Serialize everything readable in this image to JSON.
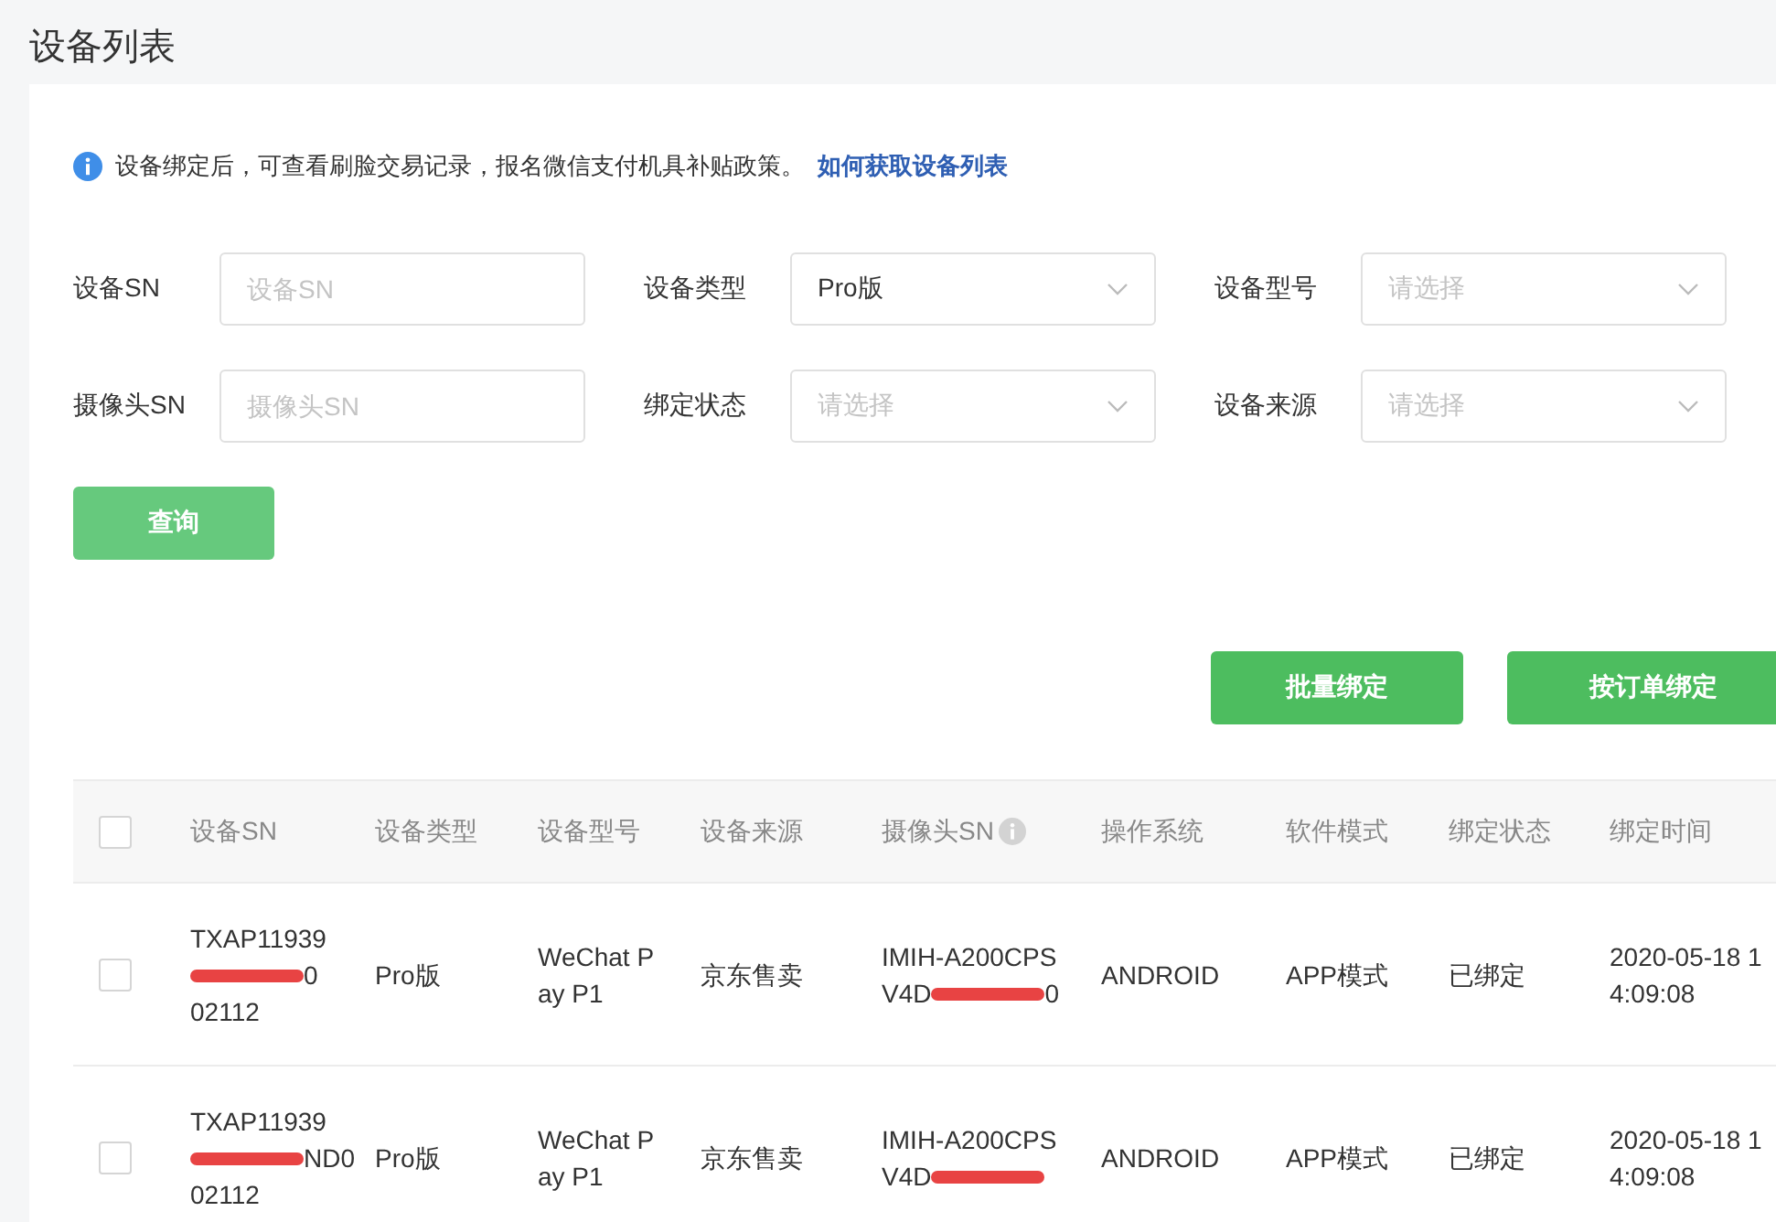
{
  "page_title": "设备列表",
  "notice": {
    "text": "设备绑定后，可查看刷脸交易记录，报名微信支付机具补贴政策。",
    "link": "如何获取设备列表"
  },
  "filters": [
    {
      "kind": "input",
      "label": "设备SN",
      "placeholder": "设备SN"
    },
    {
      "kind": "select",
      "label": "设备类型",
      "value": "Pro版"
    },
    {
      "kind": "select",
      "label": "设备型号",
      "placeholder": "请选择"
    },
    {
      "kind": "input",
      "label": "摄像头SN",
      "placeholder": "摄像头SN"
    },
    {
      "kind": "select",
      "label": "绑定状态",
      "placeholder": "请选择"
    },
    {
      "kind": "select",
      "label": "设备来源",
      "placeholder": "请选择"
    }
  ],
  "query_button": "查询",
  "actions": [
    "批量绑定",
    "按订单绑定"
  ],
  "table": {
    "all_checked": false,
    "columns": [
      {
        "label": "设备SN",
        "info": false
      },
      {
        "label": "设备类型",
        "info": false
      },
      {
        "label": "设备型号",
        "info": false
      },
      {
        "label": "设备来源",
        "info": false
      },
      {
        "label": "摄像头SN",
        "info": true
      },
      {
        "label": "操作系统",
        "info": false
      },
      {
        "label": "软件模式",
        "info": false
      },
      {
        "label": "绑定状态",
        "info": false
      },
      {
        "label": "绑定时间",
        "info": false
      }
    ],
    "rows": [
      {
        "checked": false,
        "cells": [
          [
            {
              "kind": "text",
              "text": "TXAP11939"
            },
            {
              "kind": "redacted",
              "after": "0"
            },
            {
              "kind": "text",
              "text": "02112"
            }
          ],
          [
            {
              "kind": "text",
              "text": "Pro版"
            }
          ],
          [
            {
              "kind": "text",
              "text": "WeChat P"
            },
            {
              "kind": "text",
              "text": "ay P1"
            }
          ],
          [
            {
              "kind": "text",
              "text": "京东售卖"
            }
          ],
          [
            {
              "kind": "text",
              "text": "IMIH-A200CPS"
            },
            {
              "kind": "redacted",
              "text": "V4D",
              "after": "0"
            }
          ],
          [
            {
              "kind": "text",
              "text": "ANDROID"
            }
          ],
          [
            {
              "kind": "text",
              "text": "APP模式"
            }
          ],
          [
            {
              "kind": "text",
              "text": "已绑定"
            }
          ],
          [
            {
              "kind": "text",
              "text": "2020-05-18 1"
            },
            {
              "kind": "text",
              "text": "4:09:08"
            }
          ]
        ]
      },
      {
        "checked": false,
        "cells": [
          [
            {
              "kind": "text",
              "text": "TXAP11939"
            },
            {
              "kind": "redacted",
              "after": "ND0"
            },
            {
              "kind": "text",
              "text": "02112"
            }
          ],
          [
            {
              "kind": "text",
              "text": "Pro版"
            }
          ],
          [
            {
              "kind": "text",
              "text": "WeChat P"
            },
            {
              "kind": "text",
              "text": "ay P1"
            }
          ],
          [
            {
              "kind": "text",
              "text": "京东售卖"
            }
          ],
          [
            {
              "kind": "text",
              "text": "IMIH-A200CPS"
            },
            {
              "kind": "redacted",
              "text": "V4D"
            }
          ],
          [
            {
              "kind": "text",
              "text": "ANDROID"
            }
          ],
          [
            {
              "kind": "text",
              "text": "APP模式"
            }
          ],
          [
            {
              "kind": "text",
              "text": "已绑定"
            }
          ],
          [
            {
              "kind": "text",
              "text": "2020-05-18 1"
            },
            {
              "kind": "text",
              "text": "4:09:08"
            }
          ]
        ]
      }
    ]
  }
}
